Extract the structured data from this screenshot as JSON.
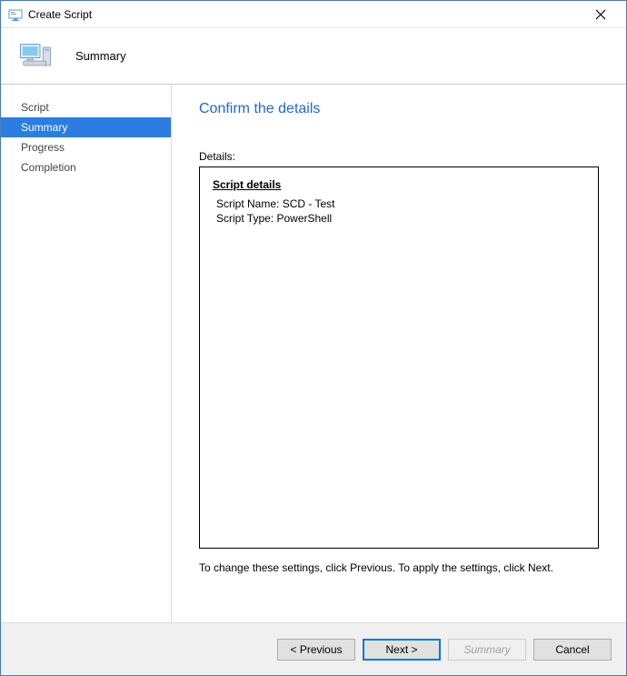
{
  "window": {
    "title": "Create Script"
  },
  "banner": {
    "title": "Summary"
  },
  "sidebar": {
    "items": [
      {
        "label": "Script",
        "active": false
      },
      {
        "label": "Summary",
        "active": true
      },
      {
        "label": "Progress",
        "active": false
      },
      {
        "label": "Completion",
        "active": false
      }
    ]
  },
  "main": {
    "heading": "Confirm the details",
    "details_label": "Details:",
    "section_head": "Script details",
    "script_name_label": "Script Name:",
    "script_name_value": "SCD - Test",
    "script_type_label": "Script Type:",
    "script_type_value": "PowerShell",
    "hint": "To change these settings, click Previous. To apply the settings, click Next."
  },
  "footer": {
    "previous": "< Previous",
    "next": "Next >",
    "summary": "Summary",
    "cancel": "Cancel"
  }
}
